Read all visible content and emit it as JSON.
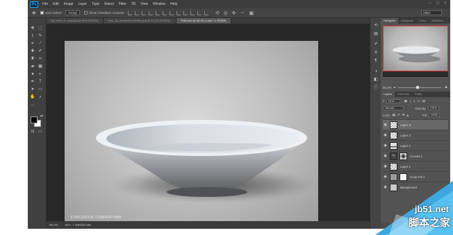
{
  "app": {
    "logo": "Ps"
  },
  "menu": [
    "File",
    "Edit",
    "Image",
    "Layer",
    "Type",
    "Select",
    "Filter",
    "3D",
    "View",
    "Window",
    "Help"
  ],
  "options": {
    "auto_select_label": "Auto-Select:",
    "auto_select_value": "Group",
    "transform_label": "Show Transform Controls",
    "workspace": "rafyA"
  },
  "tabs": [
    {
      "label": "big_bowl_of_soup.jpg @ 50% (RGB/8)",
      "active": false
    },
    {
      "label": "soup_by_frompatio-d3b8l5p.jpg @ 33.3% (RGB/8) *",
      "active": false
    },
    {
      "label": "Plate.psd @ 56.4% (Layer 3, RGB/8)",
      "active": true
    }
  ],
  "image": {
    "credit": "© FACEBOOK.COM/RAFYA88"
  },
  "status": {
    "zoom": "56.4%",
    "doc": "Doc: 7.49M/20.8M"
  },
  "panels": {
    "nav_tabs": [
      "Navigator",
      "Histogram",
      "Color",
      "Swatches"
    ],
    "nav_zoom": "56.4%",
    "nav_zoom_fraction": 0.45,
    "layer_tabs": [
      "Layers",
      "Channels",
      "Paths"
    ],
    "kind_label": "Kind",
    "blend_mode": "Normal",
    "opacity_label": "Opacity:",
    "opacity_value": "100%",
    "lock_label": "Lock:",
    "fill_label": "Fill:",
    "fill_value": "100%",
    "layers": [
      {
        "name": "Layer 4",
        "selected": true
      },
      {
        "name": "Layer 3",
        "selected": false
      },
      {
        "name": "Layer 2",
        "selected": false
      },
      {
        "name": "Curves 1",
        "selected": false
      },
      {
        "name": "Layer 1",
        "selected": false
      },
      {
        "name": "Color Fill 1",
        "selected": false
      },
      {
        "name": "Background",
        "selected": false
      }
    ]
  },
  "watermark": {
    "domain": "jb51.net",
    "name": "脚本之家"
  },
  "colors": {
    "accent_nav_frame": "#e03030",
    "brand_ps": "#31a8ff",
    "selected_layer": "#696969"
  }
}
